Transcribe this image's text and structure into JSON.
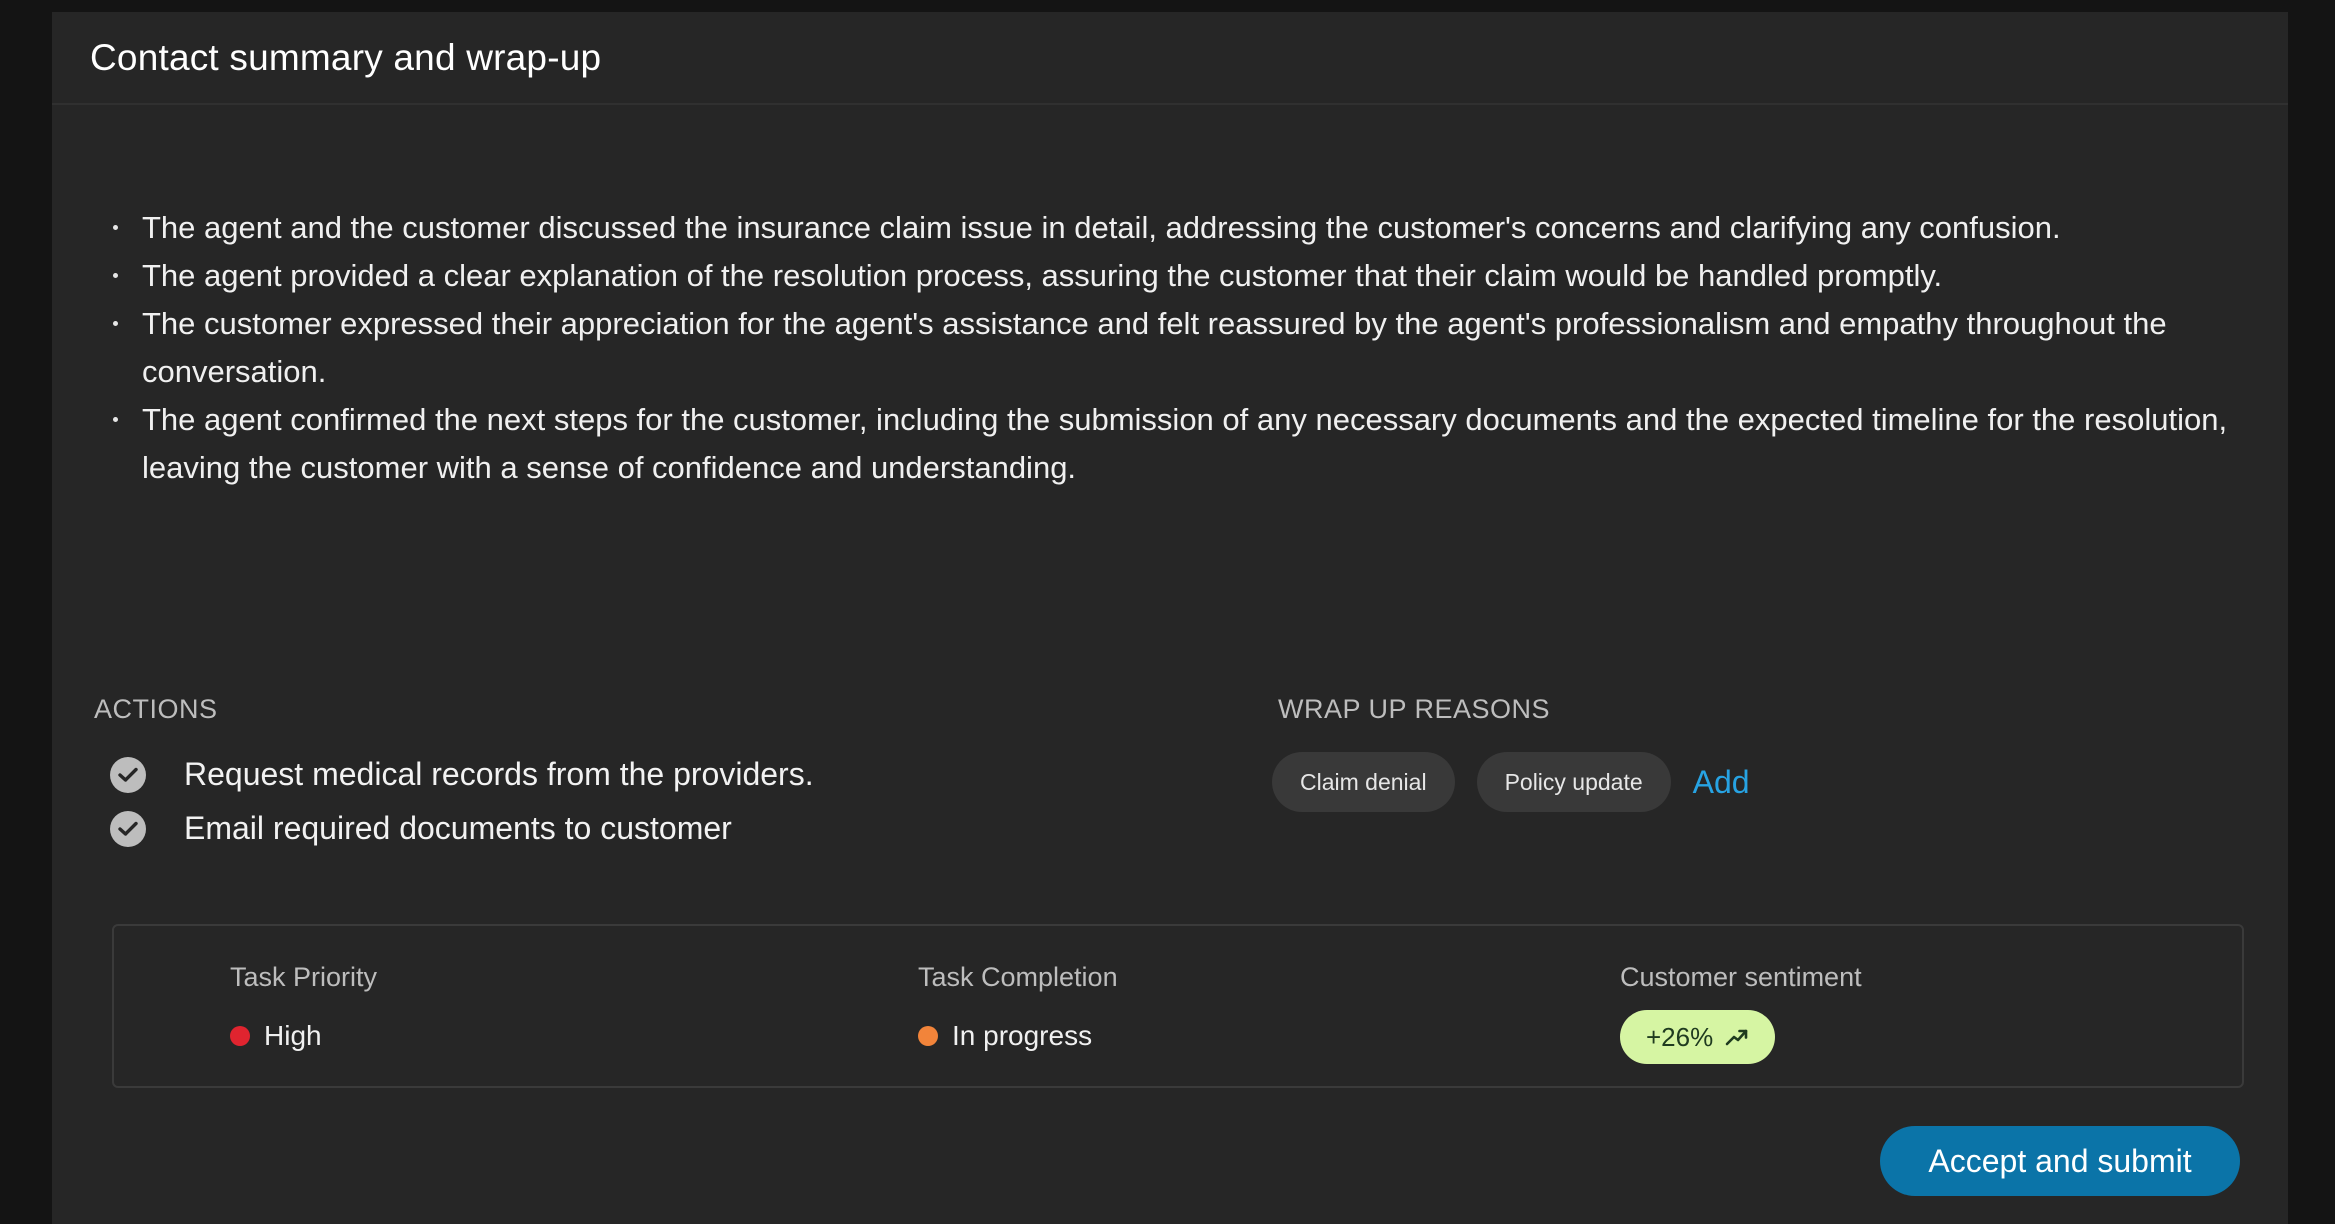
{
  "header": {
    "title": "Contact summary and wrap-up"
  },
  "summary": {
    "items": [
      "The agent and the customer discussed the insurance claim issue in detail, addressing the customer's concerns and clarifying any confusion.",
      "The agent provided a clear explanation of the resolution process, assuring the customer that their claim would be handled promptly.",
      "The customer expressed their appreciation for the agent's assistance and felt reassured by the agent's professionalism and empathy throughout the conversation.",
      "The agent confirmed the next steps for the customer, including the submission of any necessary documents and the expected timeline for the resolution, leaving the customer with a sense of confidence and understanding."
    ]
  },
  "actions": {
    "label": "ACTIONS",
    "items": [
      {
        "text": "Request medical records from the providers.",
        "icon": "check-circle-icon"
      },
      {
        "text": "Email required documents to customer",
        "icon": "check-circle-icon"
      }
    ]
  },
  "wrap_up": {
    "label": "WRAP UP REASONS",
    "reasons": [
      "Claim denial",
      "Policy update"
    ],
    "add_label": "Add"
  },
  "stats": {
    "priority": {
      "label": "Task Priority",
      "value": "High",
      "color": "#e0242f"
    },
    "completion": {
      "label": "Task Completion",
      "value": "In progress",
      "color": "#f2843a"
    },
    "sentiment": {
      "label": "Customer sentiment",
      "value": "+26%",
      "icon": "trend-up-icon",
      "color": "#d6f5a3"
    }
  },
  "footer": {
    "submit_label": "Accept and submit"
  },
  "colors": {
    "accent": "#0b74a8",
    "link": "#27a3e3",
    "panel_bg": "#262626",
    "page_bg": "#141414"
  }
}
